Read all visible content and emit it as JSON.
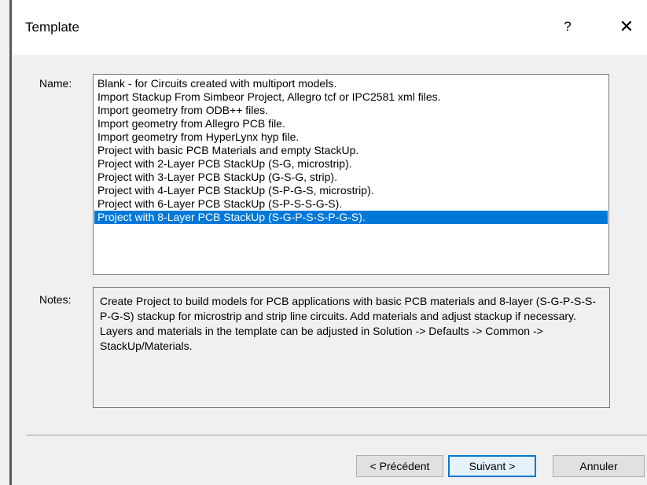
{
  "window": {
    "title": "Template",
    "help_label": "?",
    "close_label": "✕"
  },
  "name_label": "Name:",
  "notes_label": "Notes:",
  "templates": [
    {
      "label": "Blank - for Circuits created with multiport models.",
      "selected": false
    },
    {
      "label": "Import Stackup From Simbeor Project, Allegro tcf or IPC2581 xml files.",
      "selected": false
    },
    {
      "label": "Import geometry from ODB++ files.",
      "selected": false
    },
    {
      "label": "Import geometry from Allegro PCB file.",
      "selected": false
    },
    {
      "label": "Import geometry from HyperLynx hyp file.",
      "selected": false
    },
    {
      "label": "Project with basic PCB Materials and empty StackUp.",
      "selected": false
    },
    {
      "label": "Project with 2-Layer PCB StackUp (S-G, microstrip).",
      "selected": false
    },
    {
      "label": "Project with 3-Layer PCB StackUp (G-S-G, strip).",
      "selected": false
    },
    {
      "label": "Project with 4-Layer PCB StackUp (S-P-G-S, microstrip).",
      "selected": false
    },
    {
      "label": "Project with 6-Layer PCB StackUp (S-P-S-S-G-S).",
      "selected": false
    },
    {
      "label": "Project with 8-Layer PCB StackUp (S-G-P-S-S-P-G-S).",
      "selected": true
    }
  ],
  "notes_text": "Create Project to build models for PCB applications with basic PCB materials and 8-layer (S-G-P-S-S-P-G-S) stackup for microstrip and strip line circuits. Add materials and adjust stackup if necessary. Layers and materials in the template can be adjusted in Solution -> Defaults -> Common -> StackUp/Materials.",
  "buttons": {
    "previous": "< Précédent",
    "next": "Suivant >",
    "cancel": "Annuler"
  },
  "colors": {
    "selection": "#0078d7",
    "dialog_bg": "#f0f0f0"
  }
}
